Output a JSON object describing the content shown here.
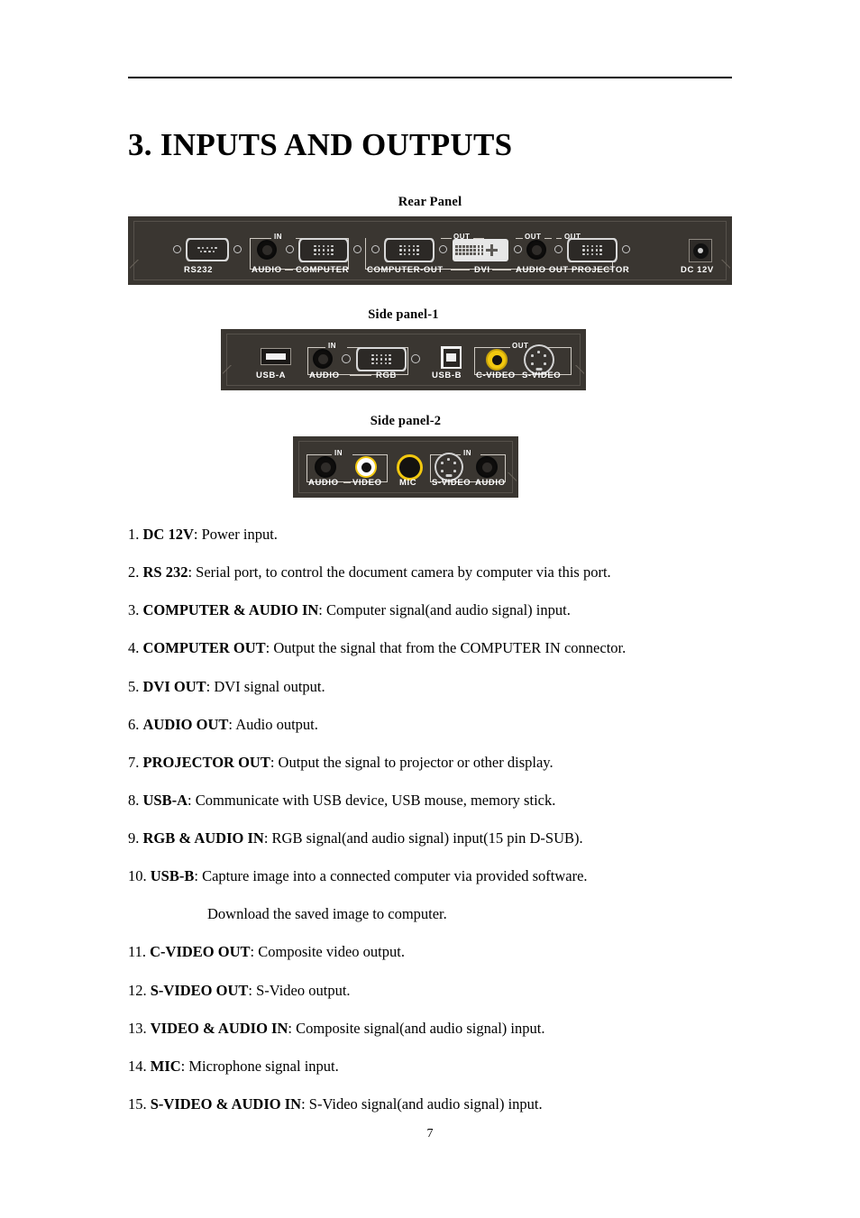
{
  "document": {
    "title": "3. INPUTS AND OUTPUTS",
    "page_number": "7"
  },
  "figures": [
    {
      "caption": "Rear Panel",
      "connectors": [
        {
          "label": "RS232",
          "type": "d-sub-9"
        },
        {
          "label": "AUDIO",
          "type": "audio-jack",
          "direction": "IN"
        },
        {
          "label": "COMPUTER",
          "type": "d-sub-15",
          "direction": "IN"
        },
        {
          "label": "COMPUTER-OUT",
          "type": "d-sub-15",
          "direction": "OUT"
        },
        {
          "label": "DVI",
          "type": "dvi",
          "direction": "OUT"
        },
        {
          "label": "AUDIO OUT",
          "type": "audio-jack",
          "direction": "OUT"
        },
        {
          "label": "PROJECTOR",
          "type": "d-sub-15",
          "direction": "OUT"
        },
        {
          "label": "DC 12V",
          "type": "power-barrel"
        }
      ]
    },
    {
      "caption": "Side panel-1",
      "connectors": [
        {
          "label": "USB-A",
          "type": "usb-a"
        },
        {
          "label": "AUDIO",
          "type": "audio-jack",
          "direction": "IN"
        },
        {
          "label": "RGB",
          "type": "d-sub-15",
          "direction": "IN"
        },
        {
          "label": "USB-B",
          "type": "usb-b"
        },
        {
          "label": "C-VIDEO",
          "type": "rca-yellow",
          "direction": "OUT"
        },
        {
          "label": "S-VIDEO",
          "type": "mini-din",
          "direction": "OUT"
        }
      ]
    },
    {
      "caption": "Side panel-2",
      "connectors": [
        {
          "label": "AUDIO",
          "type": "audio-jack",
          "direction": "IN"
        },
        {
          "label": "VIDEO",
          "type": "rca-yellow",
          "direction": "IN"
        },
        {
          "label": "MIC",
          "type": "mic-jack"
        },
        {
          "label": "S-VIDEO",
          "type": "mini-din",
          "direction": "IN"
        },
        {
          "label": "AUDIO",
          "type": "audio-jack",
          "direction": "IN"
        }
      ]
    }
  ],
  "panel_labels": {
    "in": "IN",
    "out": "OUT",
    "rear": {
      "rs232": "RS232",
      "audio": "AUDIO",
      "computer": "COMPUTER",
      "computer_out": "COMPUTER-OUT",
      "dvi": "DVI",
      "audio_out": "AUDIO OUT",
      "projector": "PROJECTOR",
      "dc12v": "DC 12V"
    },
    "side1": {
      "usba": "USB-A",
      "audio": "AUDIO",
      "rgb": "RGB",
      "usbb": "USB-B",
      "cvideo": "C-VIDEO",
      "svideo": "S-VIDEO"
    },
    "side2": {
      "audio_left": "AUDIO",
      "video": "VIDEO",
      "mic": "MIC",
      "svideo": "S-VIDEO",
      "audio_right": "AUDIO"
    }
  },
  "items": [
    {
      "num": "1.",
      "term": "DC 12V",
      "desc": ": Power input."
    },
    {
      "num": "2.",
      "term": "RS 232",
      "desc": ": Serial port, to control the document camera by computer via this port."
    },
    {
      "num": "3.",
      "term": "COMPUTER & AUDIO IN",
      "desc": ": Computer signal(and audio signal) input."
    },
    {
      "num": "4.",
      "term": "COMPUTER OUT",
      "desc": ": Output the signal that from the COMPUTER IN connector."
    },
    {
      "num": "5.",
      "term": "DVI OUT",
      "desc": ": DVI signal output."
    },
    {
      "num": "6.",
      "term": "AUDIO OUT",
      "desc": ": Audio output."
    },
    {
      "num": "7.",
      "term": "PROJECTOR OUT",
      "desc": ": Output the signal to projector or other display."
    },
    {
      "num": "8.",
      "term": "USB-A",
      "desc": ": Communicate with USB device, USB mouse, memory stick."
    },
    {
      "num": "9.",
      "term": "RGB & AUDIO IN",
      "desc": ": RGB signal(and audio signal) input(15 pin D-SUB)."
    },
    {
      "num": "10.",
      "term": "USB-B",
      "desc": ": Capture image into a connected computer via provided software.",
      "continuation": "Download the saved image to computer."
    },
    {
      "num": "11.",
      "term": "C-VIDEO OUT",
      "desc": ": Composite video output."
    },
    {
      "num": "12.",
      "term": "S-VIDEO OUT",
      "desc": ": S-Video output."
    },
    {
      "num": "13.",
      "term": "VIDEO & AUDIO IN",
      "desc": ": Composite signal(and audio signal) input."
    },
    {
      "num": "14.",
      "term": "MIC",
      "desc": ": Microphone signal input."
    },
    {
      "num": "15.",
      "term": "S-VIDEO & AUDIO IN",
      "desc": ": S-Video signal(and audio signal) input."
    }
  ],
  "colors": {
    "panel_bg": "#3a3631",
    "panel_label": "#ffffff",
    "yellow_jack": "#f2c80f",
    "metal": "#d8d8d8"
  }
}
